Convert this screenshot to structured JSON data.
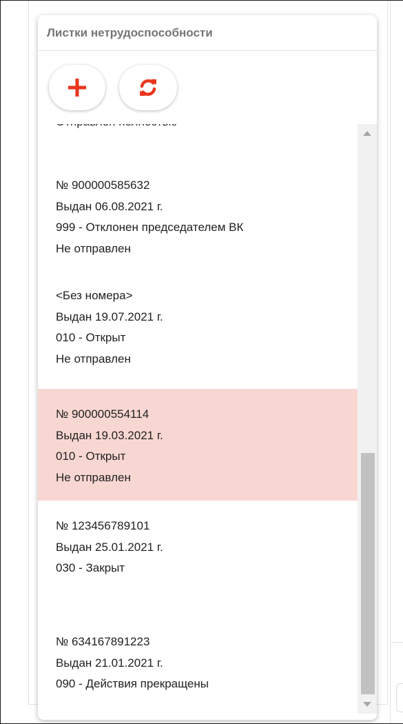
{
  "panel": {
    "title": "Листки нетрудоспособности",
    "add_icon": "plus-icon",
    "refresh_icon": "refresh-icon",
    "accent_color": "#e8361e"
  },
  "list": {
    "partial_item": {
      "line1": "Отправлен полностью"
    },
    "items": [
      {
        "number": "№ 900000585632",
        "issued": "Выдан 06.08.2021 г.",
        "status": "999 - Отклонен председателем ВК",
        "sent": "Не отправлен",
        "selected": false
      },
      {
        "number": "<Без номера>",
        "issued": "Выдан 19.07.2021 г.",
        "status": "010 - Открыт",
        "sent": "Не отправлен",
        "selected": false
      },
      {
        "number": "№ 900000554114",
        "issued": "Выдан 19.03.2021 г.",
        "status": "010 - Открыт",
        "sent": "Не отправлен",
        "selected": true
      },
      {
        "number": "№ 123456789101",
        "issued": "Выдан 25.01.2021 г.",
        "status": "030 - Закрыт",
        "sent": "",
        "selected": false
      },
      {
        "number": "№ 634167891223",
        "issued": "Выдан 21.01.2021 г.",
        "status": "090 - Действия прекращены",
        "sent": "",
        "selected": false
      }
    ],
    "selected_color": "#f8d7d2"
  },
  "scrollbar": {
    "up_icon": "scroll-up-arrow-icon",
    "down_icon": "scroll-down-arrow-icon"
  }
}
